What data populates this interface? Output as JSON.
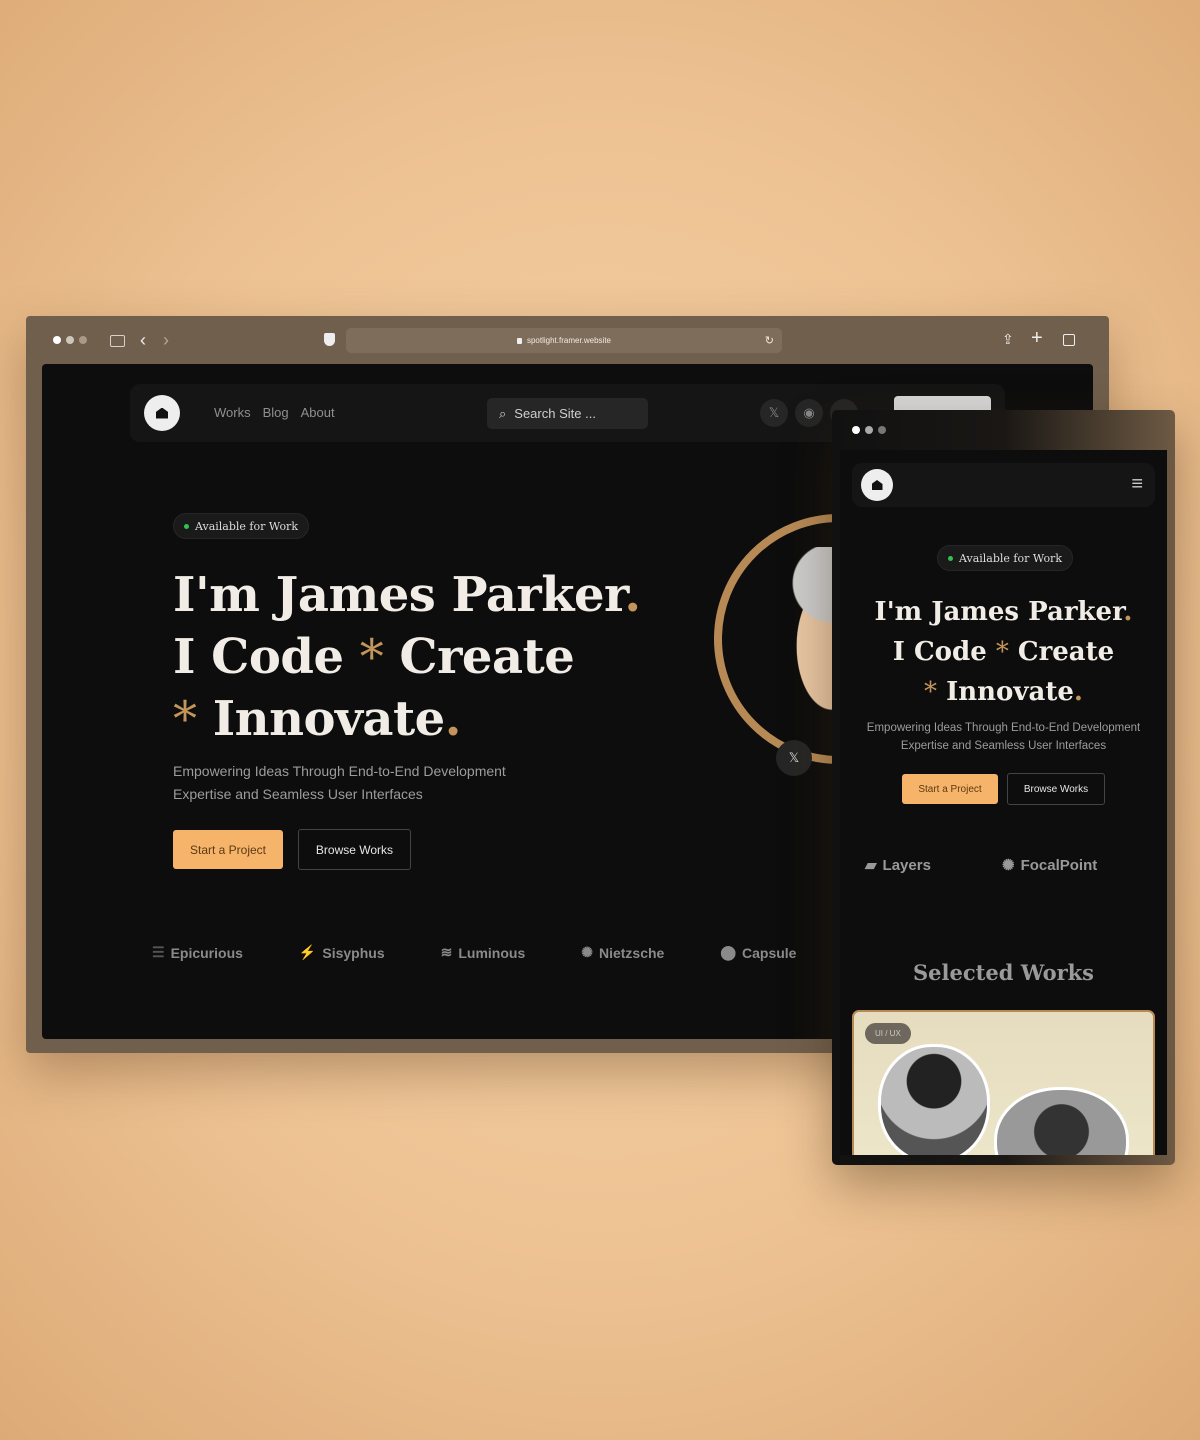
{
  "browser": {
    "url": "spotlight.framer.website"
  },
  "nav": {
    "links": [
      "Works",
      "Blog",
      "About"
    ],
    "search_placeholder": "Search Site ..."
  },
  "hero": {
    "badge": "Available for Work",
    "line1": "I'm James Parker",
    "line1_dot": ".",
    "line2a": "I Code",
    "star": "*",
    "line2b": "Create",
    "line3": "Innovate",
    "line3_dot": ".",
    "subtitle1": "Empowering Ideas Through End-to-End Development",
    "subtitle2": "Expertise and Seamless User Interfaces",
    "primary_cta": "Start a Project",
    "secondary_cta": "Browse Works"
  },
  "brands": [
    "Epicurious",
    "Sisyphus",
    "Luminous",
    "Nietzsche",
    "Capsule"
  ],
  "mobile": {
    "brands": [
      "Layers",
      "FocalPoint"
    ],
    "section_title": "Selected Works",
    "card_tag": "UI / UX"
  },
  "colors": {
    "accent": "#c4955a",
    "cta": "#f6b46b",
    "status": "#2fc24f",
    "frame": "#705f4c"
  }
}
